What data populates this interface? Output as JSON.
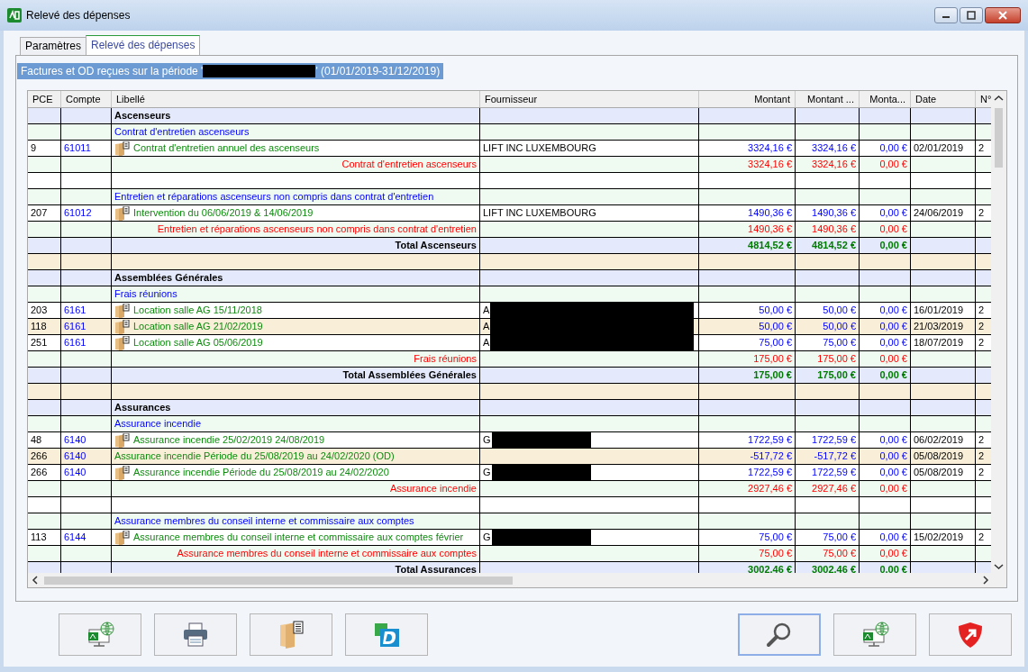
{
  "window": {
    "title": "Relevé des dépenses"
  },
  "tabs": [
    {
      "label": "Paramètres",
      "selected": false
    },
    {
      "label": "Relevé des dépenses",
      "selected": true
    }
  ],
  "period": {
    "prefix": "Factures et OD reçues sur la période '",
    "redacted": true,
    "suffix": "' (01/01/2019-31/12/2019)"
  },
  "table": {
    "columns": [
      "PCE",
      "Compte",
      "Libellé",
      "Fournisseur",
      "Montant",
      "Montant ...",
      "Monta...",
      "Date",
      "N°"
    ],
    "rows": [
      {
        "kind": "section",
        "label": "Ascenseurs"
      },
      {
        "kind": "group",
        "label": "Contrat d'entretien ascenseurs"
      },
      {
        "kind": "entry",
        "tinted": false,
        "pce": "9",
        "account": "61011",
        "attachment": true,
        "label": "Contrat d'entretien annuel des ascenseurs",
        "supplier": "LIFT INC LUXEMBOURG",
        "redacted": false,
        "amounts": [
          "3324,16 €",
          "3324,16 €",
          "0,00 €"
        ],
        "date": "02/01/2019",
        "number": "2"
      },
      {
        "kind": "subtotal",
        "label": "Contrat d'entretien ascenseurs",
        "amounts": [
          "3324,16 €",
          "3324,16 €",
          "0,00 €"
        ]
      },
      {
        "kind": "blank",
        "tinted": false
      },
      {
        "kind": "group",
        "label": "Entretien et réparations ascenseurs non compris dans contrat d'entretien"
      },
      {
        "kind": "entry",
        "tinted": false,
        "pce": "207",
        "account": "61012",
        "attachment": true,
        "label": "Intervention du 06/06/2019 & 14/06/2019",
        "supplier": "LIFT INC LUXEMBOURG",
        "redacted": false,
        "amounts": [
          "1490,36 €",
          "1490,36 €",
          "0,00 €"
        ],
        "date": "24/06/2019",
        "number": "2"
      },
      {
        "kind": "subtotal",
        "label": "Entretien et réparations ascenseurs non compris dans contrat d'entretien",
        "amounts": [
          "1490,36 €",
          "1490,36 €",
          "0,00 €"
        ]
      },
      {
        "kind": "total",
        "label": "Total Ascenseurs",
        "amounts": [
          "4814,52 €",
          "4814,52 €",
          "0,00 €"
        ]
      },
      {
        "kind": "blank",
        "tinted": true
      },
      {
        "kind": "section",
        "label": "Assemblées Générales"
      },
      {
        "kind": "group",
        "label": "Frais réunions"
      },
      {
        "kind": "entry",
        "tinted": false,
        "pce": "203",
        "account": "6161",
        "attachment": true,
        "label": "Location salle AG 15/11/2018",
        "supplier": "A",
        "redacted": true,
        "amounts": [
          "50,00 €",
          "50,00 €",
          "0,00 €"
        ],
        "date": "16/01/2019",
        "number": "2"
      },
      {
        "kind": "entry",
        "tinted": true,
        "pce": "118",
        "account": "6161",
        "attachment": true,
        "label": "Location salle AG 21/02/2019",
        "supplier": "A",
        "redacted": true,
        "amounts": [
          "50,00 €",
          "50,00 €",
          "0,00 €"
        ],
        "date": "21/03/2019",
        "number": "2"
      },
      {
        "kind": "entry",
        "tinted": false,
        "pce": "251",
        "account": "6161",
        "attachment": true,
        "label": "Location salle AG 05/06/2019",
        "supplier": "A",
        "redacted": true,
        "amounts": [
          "75,00 €",
          "75,00 €",
          "0,00 €"
        ],
        "date": "18/07/2019",
        "number": "2"
      },
      {
        "kind": "subtotal",
        "label": "Frais réunions",
        "amounts": [
          "175,00 €",
          "175,00 €",
          "0,00 €"
        ]
      },
      {
        "kind": "total",
        "label": "Total Assemblées Générales",
        "amounts": [
          "175,00 €",
          "175,00 €",
          "0,00 €"
        ]
      },
      {
        "kind": "blank",
        "tinted": true
      },
      {
        "kind": "section",
        "label": "Assurances"
      },
      {
        "kind": "group",
        "label": "Assurance incendie"
      },
      {
        "kind": "entry",
        "tinted": false,
        "pce": "48",
        "account": "6140",
        "attachment": true,
        "label": "Assurance incendie 25/02/2019 24/08/2019",
        "supplier": "G",
        "redacted": true,
        "amounts": [
          "1722,59 €",
          "1722,59 €",
          "0,00 €"
        ],
        "date": "06/02/2019",
        "number": "2"
      },
      {
        "kind": "entry",
        "tinted": true,
        "pce": "266",
        "account": "6140",
        "attachment": false,
        "label": "Assurance incendie Période du 25/08/2019 au 24/02/2020 (OD)",
        "redacted": false,
        "amounts": [
          "-517,72 €",
          "-517,72 €",
          "0,00 €"
        ],
        "date": "05/08/2019",
        "number": "2"
      },
      {
        "kind": "entry",
        "tinted": false,
        "pce": "266",
        "account": "6140",
        "attachment": true,
        "label": "Assurance incendie Période du 25/08/2019 au 24/02/2020",
        "supplier": "G",
        "redacted": true,
        "amounts": [
          "1722,59 €",
          "1722,59 €",
          "0,00 €"
        ],
        "date": "05/08/2019",
        "number": "2"
      },
      {
        "kind": "subtotal",
        "label": "Assurance incendie",
        "amounts": [
          "2927,46 €",
          "2927,46 €",
          "0,00 €"
        ]
      },
      {
        "kind": "blank",
        "tinted": false
      },
      {
        "kind": "group",
        "label": "Assurance membres du conseil interne et commissaire aux comptes"
      },
      {
        "kind": "entry",
        "tinted": false,
        "pce": "113",
        "account": "6144",
        "attachment": true,
        "label": "Assurance membres du conseil interne et commissaire aux comptes février",
        "supplier": "G",
        "redacted": true,
        "amounts": [
          "75,00 €",
          "75,00 €",
          "0,00 €"
        ],
        "date": "15/02/2019",
        "number": "2"
      },
      {
        "kind": "subtotal",
        "label": "Assurance membres du conseil interne et commissaire aux comptes",
        "amounts": [
          "75,00 €",
          "75,00 €",
          "0,00 €"
        ]
      },
      {
        "kind": "total",
        "label": "Total Assurances",
        "amounts": [
          "3002,46 €",
          "3002,46 €",
          "0,00 €"
        ]
      }
    ]
  },
  "toolbar": [
    {
      "kind": "web",
      "focused": false
    },
    {
      "kind": "print",
      "focused": false
    },
    {
      "kind": "attach",
      "focused": false
    },
    {
      "kind": "d-logo",
      "focused": false
    },
    {
      "kind": "spacer"
    },
    {
      "kind": "search",
      "focused": true
    },
    {
      "kind": "web",
      "focused": false
    },
    {
      "kind": "shield",
      "focused": false
    }
  ]
}
